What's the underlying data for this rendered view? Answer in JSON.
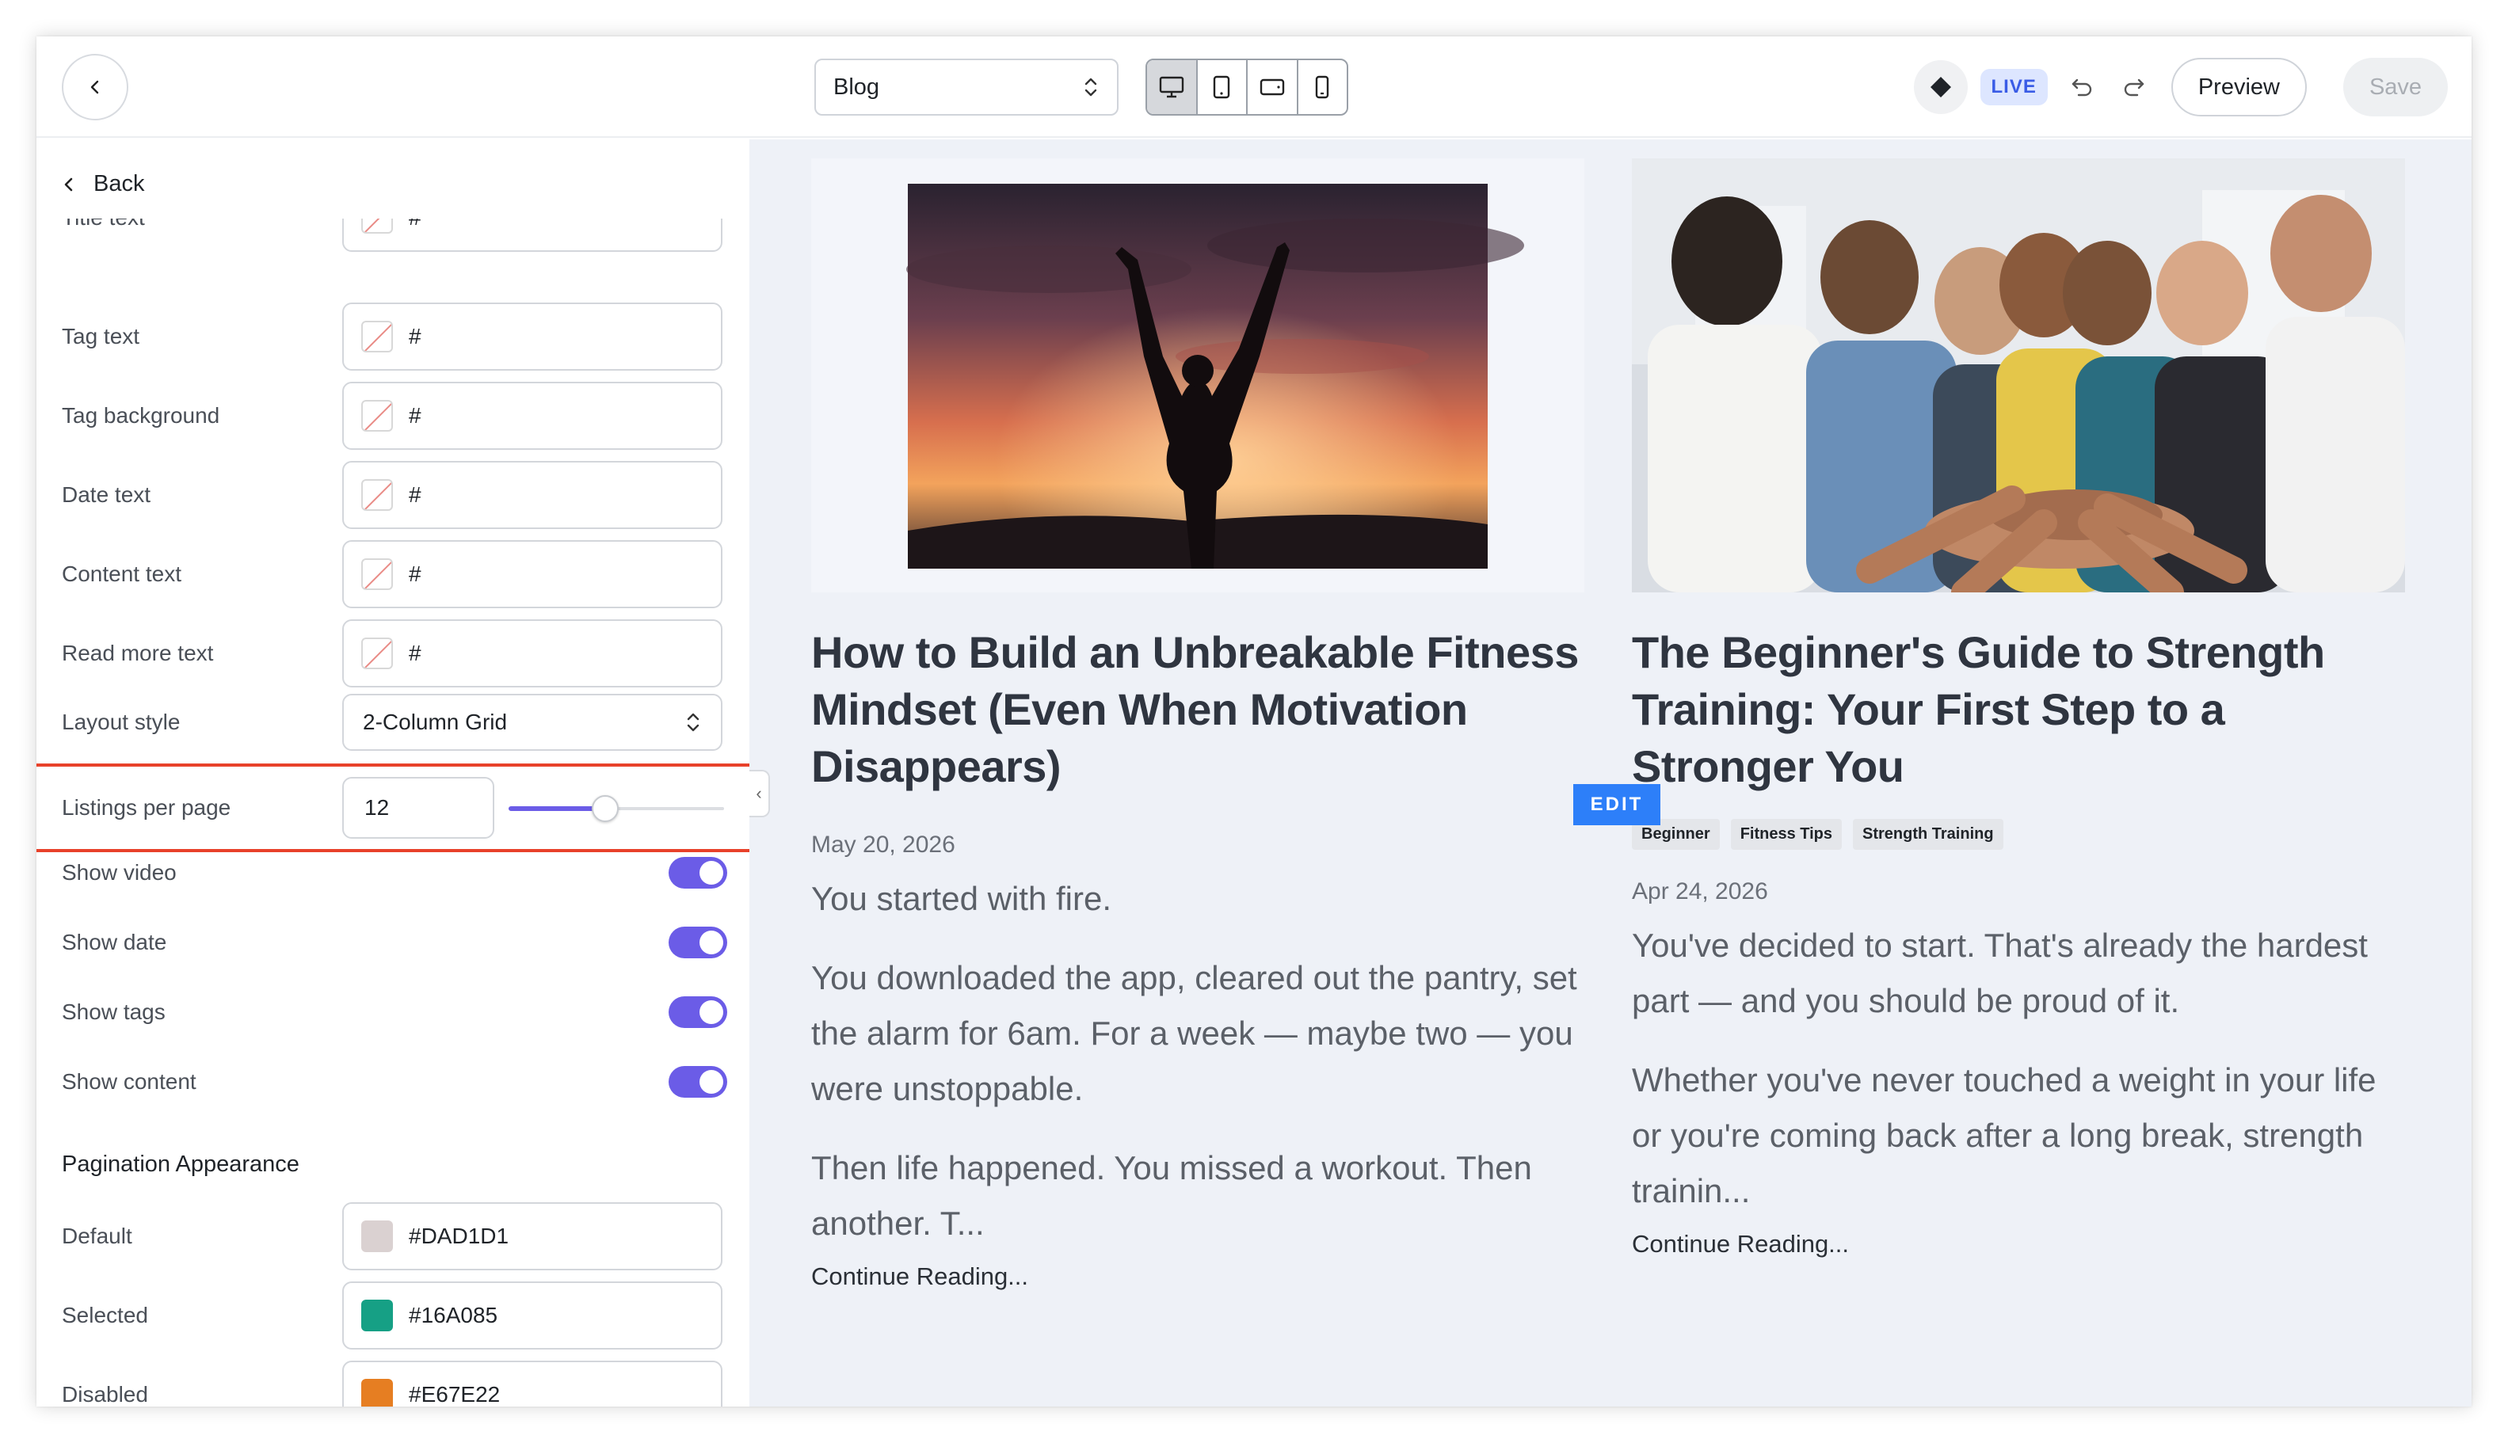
{
  "topbar": {
    "page_select": "Blog",
    "devices": [
      "desktop-icon",
      "tablet-portrait-icon",
      "tablet-landscape-icon",
      "mobile-icon"
    ],
    "live_label": "LIVE",
    "preview_label": "Preview",
    "save_label": "Save"
  },
  "panel": {
    "back_label": "Back",
    "partial_label": "Title text",
    "colors": [
      {
        "label": "Tag text",
        "value": "#"
      },
      {
        "label": "Tag background",
        "value": "#"
      },
      {
        "label": "Date text",
        "value": "#"
      },
      {
        "label": "Content text",
        "value": "#"
      },
      {
        "label": "Read more text",
        "value": "#"
      }
    ],
    "layout_style": {
      "label": "Layout style",
      "value": "2-Column Grid"
    },
    "listings": {
      "label": "Listings per page",
      "value": "12",
      "slider_fraction": 0.45
    },
    "toggles": [
      {
        "label": "Show video",
        "on": true
      },
      {
        "label": "Show date",
        "on": true
      },
      {
        "label": "Show tags",
        "on": true
      },
      {
        "label": "Show content",
        "on": true
      }
    ],
    "pagination_title": "Pagination Appearance",
    "pagination": [
      {
        "label": "Default",
        "value": "#DAD1D1",
        "color": "#DAD1D1"
      },
      {
        "label": "Selected",
        "value": "#16A085",
        "color": "#16A085"
      },
      {
        "label": "Disabled",
        "value": "#E67E22",
        "color": "#E67E22"
      }
    ]
  },
  "posts": [
    {
      "title": "How to Build an Unbreakable Fitness Mindset (Even When Motivation Disappears)",
      "date": "May 20, 2026",
      "paragraphs": [
        "You started with fire.",
        "You downloaded the app, cleared out the pantry, set the alarm for 6am. For a week — maybe two — you were unstoppable.",
        "Then life happened. You missed a workout. Then another. T..."
      ],
      "continue": "Continue Reading..."
    },
    {
      "title": "The Beginner's Guide to Strength Training: Your First Step to a Stronger You",
      "tags": [
        "Beginner",
        "Fitness Tips",
        "Strength Training"
      ],
      "date": "Apr 24, 2026",
      "paragraphs": [
        "You've decided to start. That's already the hardest part — and you should be proud of it.",
        "Whether you've never touched a weight in your life or you're coming back after a long break, strength trainin..."
      ],
      "continue": "Continue Reading..."
    }
  ],
  "edit_badge": "EDIT",
  "colors": {
    "accent": "#6b5ce7",
    "highlight": "#e8412a",
    "edit": "#2d7ff9",
    "live_bg": "#dde6ff"
  }
}
